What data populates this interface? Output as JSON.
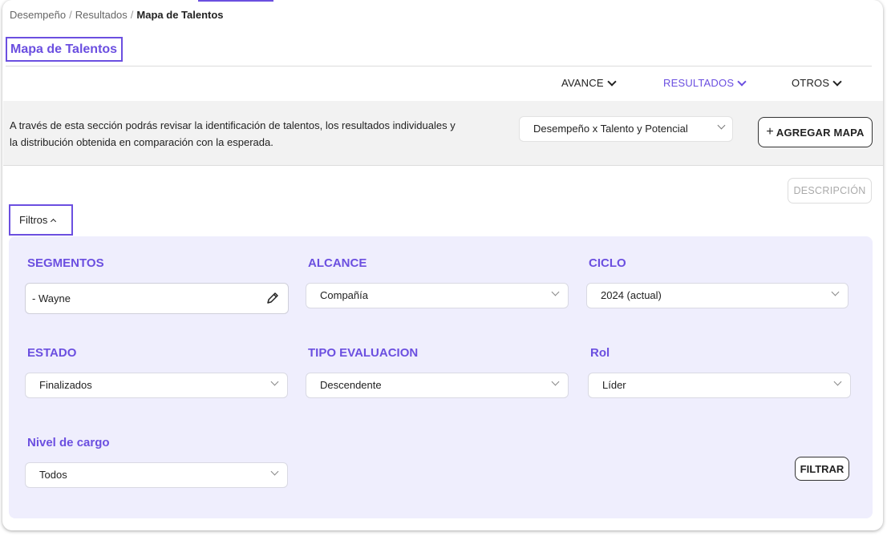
{
  "breadcrumb": {
    "items": [
      "Desempeño",
      "Resultados"
    ],
    "current": "Mapa de Talentos"
  },
  "page": {
    "title": "Mapa de Talentos"
  },
  "nav": {
    "avance": "AVANCE",
    "resultados": "RESULTADOS",
    "otros": "OTROS",
    "active": "RESULTADOS"
  },
  "intro": {
    "text": "A través de esta sección podrás revisar la identificación de talentos, los resultados individuales y la distribución obtenida en comparación con la esperada.",
    "map_select": "Desempeño x Talento y Potencial",
    "add_map_label": "AGREGAR MAPA",
    "add_map_icon": "+"
  },
  "description_button": "DESCRIPCIÓN",
  "filters": {
    "toggle_label": "Filtros",
    "segmentos": {
      "label": "SEGMENTOS",
      "value": "- Wayne"
    },
    "alcance": {
      "label": "ALCANCE",
      "value": "Compañía"
    },
    "ciclo": {
      "label": "CICLO",
      "value": "2024 (actual)"
    },
    "estado": {
      "label": "ESTADO",
      "value": "Finalizados"
    },
    "tipo_evaluacion": {
      "label": "TIPO EVALUACION",
      "value": "Descendente"
    },
    "rol": {
      "label": "Rol",
      "value": "Líder"
    },
    "nivel_cargo": {
      "label": "Nivel de cargo",
      "value": "Todos"
    },
    "submit_label": "FILTRAR"
  },
  "colors": {
    "accent": "#6b4fe0",
    "panel_bg": "#efeefd",
    "intro_bg": "#f2f2f2"
  }
}
